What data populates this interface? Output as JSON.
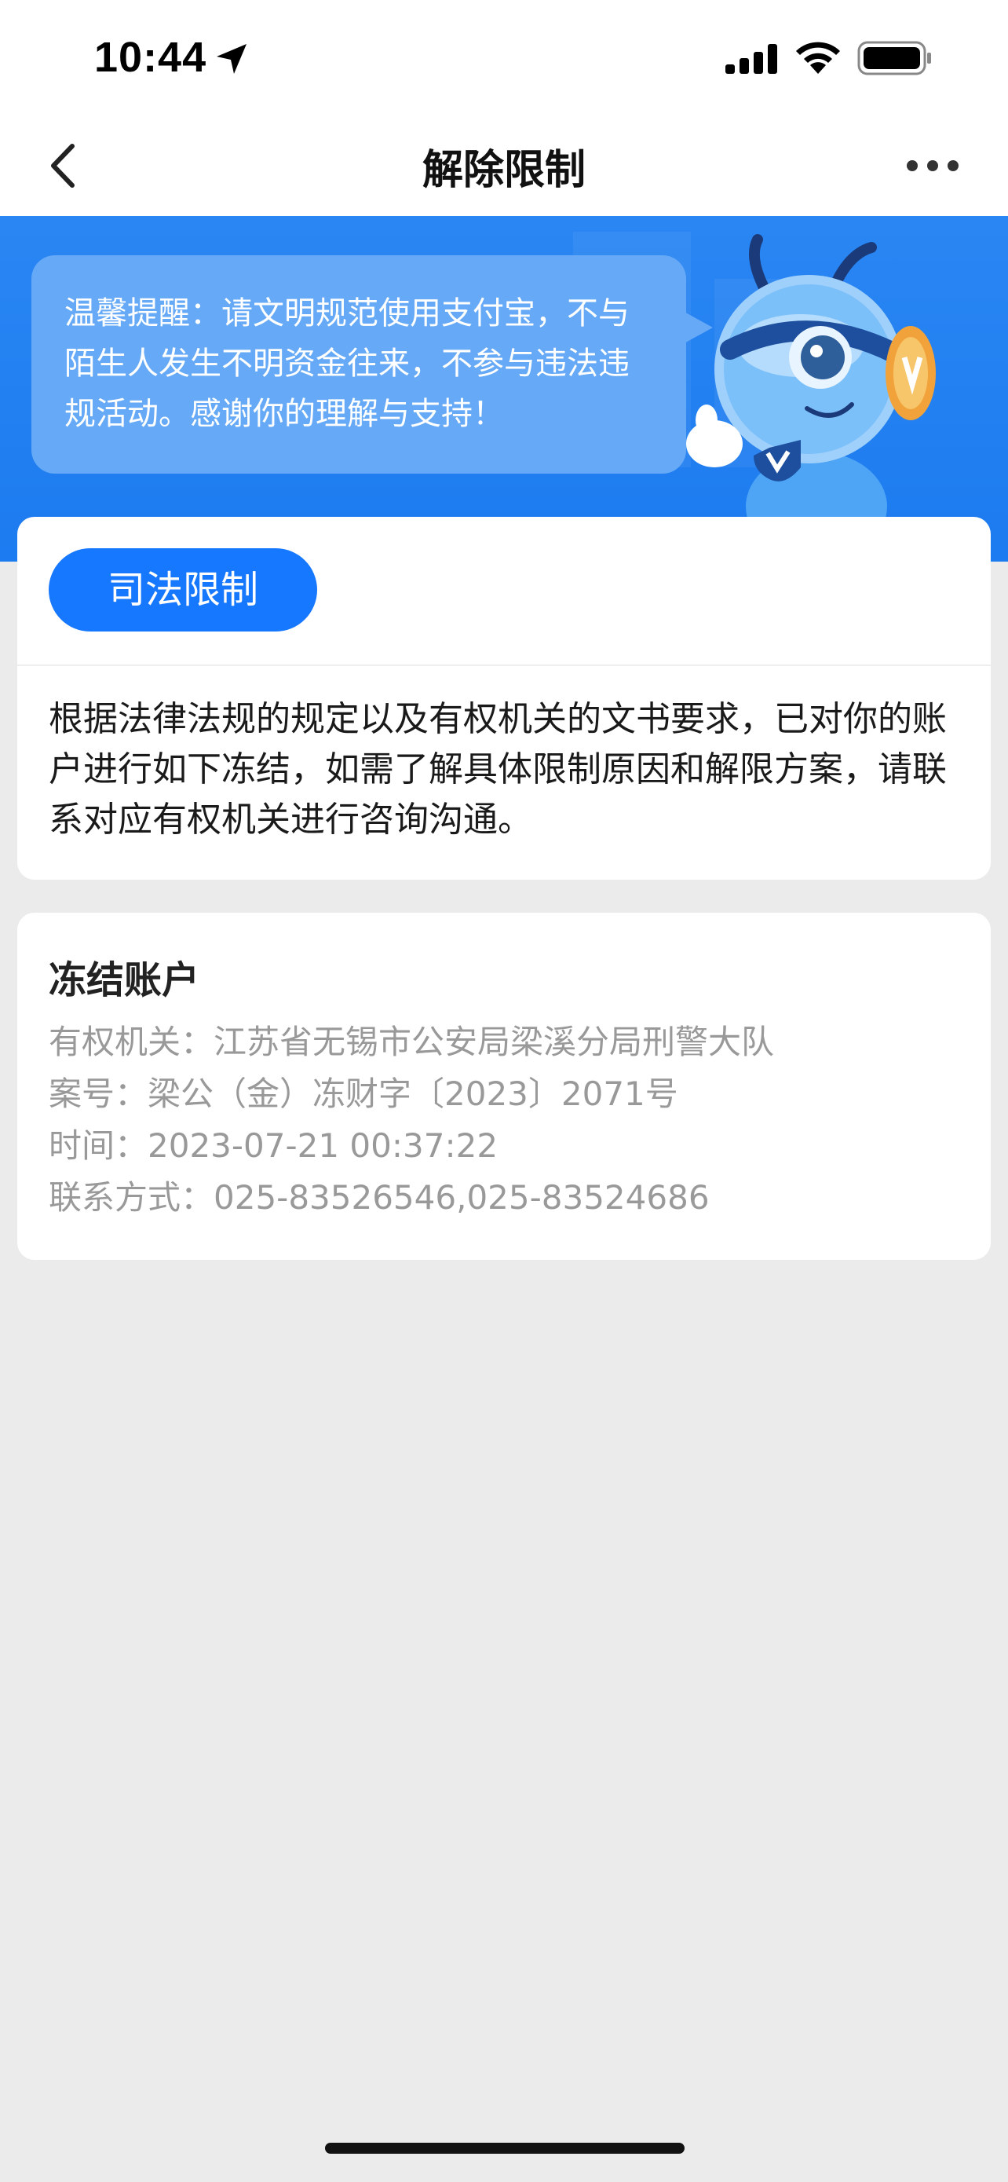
{
  "status_bar": {
    "time": "10:44",
    "icons": [
      "location-arrow-icon",
      "signal-icon",
      "wifi-icon",
      "battery-icon"
    ]
  },
  "nav": {
    "title": "解除限制",
    "back_icon": "chevron-left-icon",
    "more_icon": "more-dots-icon"
  },
  "banner": {
    "reminder_text": "温馨提醒：请文明规范使用支付宝，不与陌生人发生不明资金往来，不参与违法违规活动。感谢你的理解与支持！",
    "mascot_icon": "ant-mascot-icon",
    "colors": {
      "banner_blue": "#1c7bf0",
      "bubble_blue": "#66a9f6"
    }
  },
  "restriction_card": {
    "tag_label": "司法限制",
    "description": "根据法律法规的规定以及有权机关的文书要求，已对你的账户进行如下冻结，如需了解具体限制原因和解限方案，请联系对应有权机关进行咨询沟通。",
    "colors": {
      "tag": "#1677ff"
    }
  },
  "frozen_account": {
    "title": "冻结账户",
    "authority": "有权机关：江苏省无锡市公安局梁溪分局刑警大队",
    "case_no": "案号：梁公（金）冻财字〔2023〕2071号",
    "time": "时间：2023-07-21 00:37:22",
    "contact": "联系方式：025-83526546,025-83524686"
  }
}
